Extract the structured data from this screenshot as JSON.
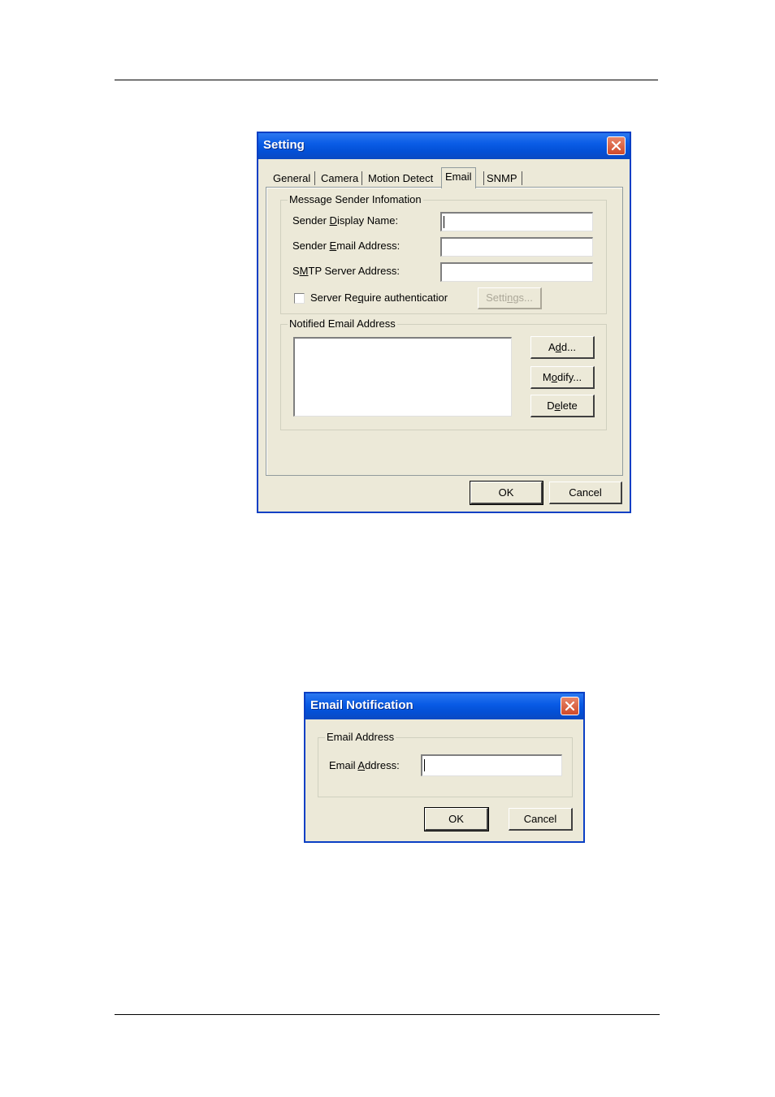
{
  "setting_dialog": {
    "title": "Setting",
    "tabs": [
      "General",
      "Camera",
      "Motion Detect",
      "Email",
      "SNMP"
    ],
    "active_tab": "Email",
    "sender_group": {
      "label": "Message Sender Infomation",
      "display_name_label": {
        "pre": "Sender ",
        "key": "D",
        "post": "isplay Name:"
      },
      "email_label": {
        "pre": "Sender ",
        "key": "E",
        "post": "mail Address:"
      },
      "smtp_label": {
        "pre": "S",
        "key": "M",
        "post": "TP Server Address:"
      },
      "display_name_value": "",
      "email_value": "",
      "smtp_value": "",
      "auth_label": {
        "pre": "Server Re",
        "key": "q",
        "post": "uire authenticatior"
      },
      "auth_checked": false,
      "settings_button": {
        "pre": "Setti",
        "key": "n",
        "post": "gs..."
      }
    },
    "notified_group": {
      "label": "Notified Email Address",
      "items": [],
      "add_button": {
        "pre": "A",
        "key": "d",
        "post": "d..."
      },
      "modify_button": {
        "pre": "M",
        "key": "o",
        "post": "dify..."
      },
      "delete_button": {
        "pre": "D",
        "key": "e",
        "post": "lete"
      }
    },
    "ok_label": "OK",
    "cancel_label": "Cancel"
  },
  "email_dialog": {
    "title": "Email Notification",
    "group_label": "Email Address",
    "field_label": {
      "pre": "Email ",
      "key": "A",
      "post": "ddress:"
    },
    "field_value": "",
    "ok_label": "OK",
    "cancel_label": "Cancel"
  },
  "icons": {
    "close": "close-x-icon",
    "checkbox": "checkbox-icon"
  },
  "colors": {
    "titlebar": "#0a5ce6",
    "close": "#cf4a2a",
    "window_bg": "#ece9d8"
  }
}
